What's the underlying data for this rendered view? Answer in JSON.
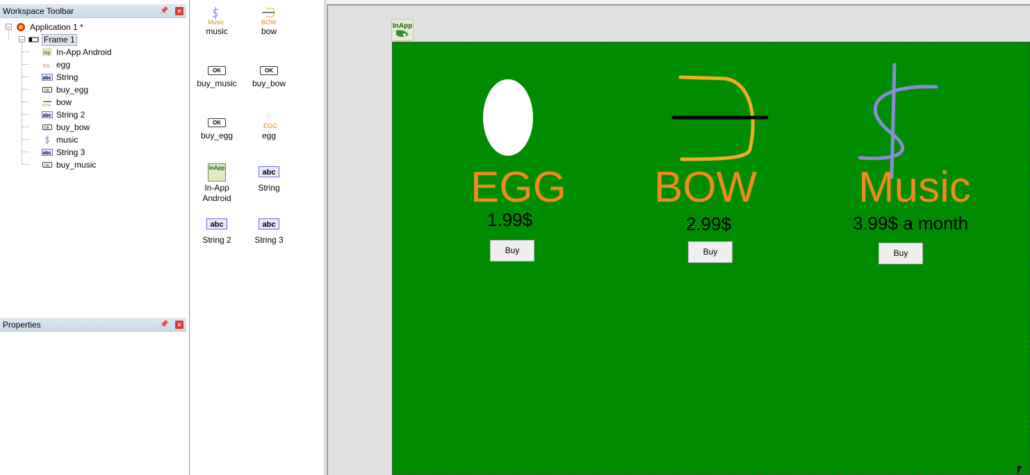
{
  "workspace": {
    "title": "Workspace Toolbar",
    "tree": [
      {
        "label": "Application 1 *",
        "icon": "application-icon",
        "depth": 0
      },
      {
        "label": "Frame 1",
        "icon": "frame-icon",
        "depth": 1,
        "selected": true
      },
      {
        "label": "In-App Android",
        "icon": "inapp-android-icon",
        "depth": 2
      },
      {
        "label": "egg",
        "icon": "image-icon",
        "depth": 2
      },
      {
        "label": "String",
        "icon": "string-icon",
        "depth": 2
      },
      {
        "label": "buy_egg",
        "icon": "button-icon",
        "depth": 2
      },
      {
        "label": "bow",
        "icon": "image-icon",
        "depth": 2
      },
      {
        "label": "String 2",
        "icon": "string-icon",
        "depth": 2
      },
      {
        "label": "buy_bow",
        "icon": "button-icon",
        "depth": 2
      },
      {
        "label": "music",
        "icon": "image-icon",
        "depth": 2
      },
      {
        "label": "String 3",
        "icon": "string-icon",
        "depth": 2
      },
      {
        "label": "buy_music",
        "icon": "button-icon",
        "depth": 2
      }
    ]
  },
  "properties": {
    "title": "Properties"
  },
  "palette": {
    "items": [
      {
        "label": "music",
        "icon": "music-image-icon",
        "thumb": "Music"
      },
      {
        "label": "bow",
        "icon": "bow-image-icon",
        "thumb": "BOW"
      },
      {
        "label": "buy_music",
        "icon": "ok-button-icon",
        "thumb": "OK"
      },
      {
        "label": "buy_bow",
        "icon": "ok-button-icon",
        "thumb": "OK"
      },
      {
        "label": "buy_egg",
        "icon": "ok-button-icon",
        "thumb": "OK"
      },
      {
        "label": "egg",
        "icon": "egg-image-icon",
        "thumb": "EGG"
      },
      {
        "label": "In-App\nAndroid",
        "icon": "inapp-android-icon",
        "thumb": "InApp"
      },
      {
        "label": "String",
        "icon": "string-icon",
        "thumb": "abc"
      },
      {
        "label": "String 2",
        "icon": "string-icon",
        "thumb": "abc"
      },
      {
        "label": "String 3",
        "icon": "string-icon",
        "thumb": "abc"
      }
    ]
  },
  "canvas": {
    "frame_icon_text": "InApp",
    "frame_color": "#008c00",
    "title_color": "#f08a1c",
    "products": [
      {
        "name": "EGG",
        "price": "1.99$",
        "button": "Buy",
        "icon": "egg-icon"
      },
      {
        "name": "BOW",
        "price": "2.99$",
        "button": "Buy",
        "icon": "bow-icon"
      },
      {
        "name": "Music",
        "price": "3.99$ a month",
        "button": "Buy",
        "icon": "dollar-music-icon"
      }
    ]
  }
}
